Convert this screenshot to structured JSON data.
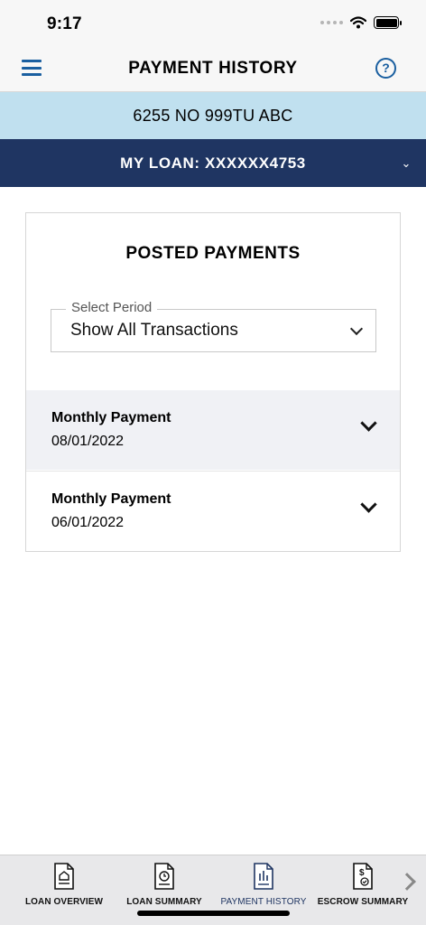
{
  "status_bar": {
    "time": "9:17"
  },
  "header": {
    "title": "PAYMENT HISTORY",
    "help_glyph": "?"
  },
  "address": "6255 NO 999TU ABC",
  "loan_selector": {
    "label": "MY LOAN: XXXXXX4753"
  },
  "posted_payments": {
    "title": "POSTED PAYMENTS",
    "period_select": {
      "legend": "Select Period",
      "value": "Show All Transactions"
    },
    "payments": [
      {
        "label": "Monthly Payment",
        "date": "08/01/2022"
      },
      {
        "label": "Monthly Payment",
        "date": "06/01/2022"
      }
    ]
  },
  "tab_bar": {
    "active_tab": "PAYMENT HISTORY",
    "tabs": [
      {
        "label": "LOAN OVERVIEW",
        "icon": "document-home-icon"
      },
      {
        "label": "LOAN SUMMARY",
        "icon": "document-clock-icon"
      },
      {
        "label": "PAYMENT HISTORY",
        "icon": "document-chart-icon"
      },
      {
        "label": "ESCROW SUMMARY",
        "icon": "document-dollar-icon"
      }
    ]
  },
  "colors": {
    "accent_blue": "#1a5fa0",
    "navy": "#1f3562",
    "address_bar": "#c0e0ef",
    "row_shade": "#f0f1f5"
  }
}
